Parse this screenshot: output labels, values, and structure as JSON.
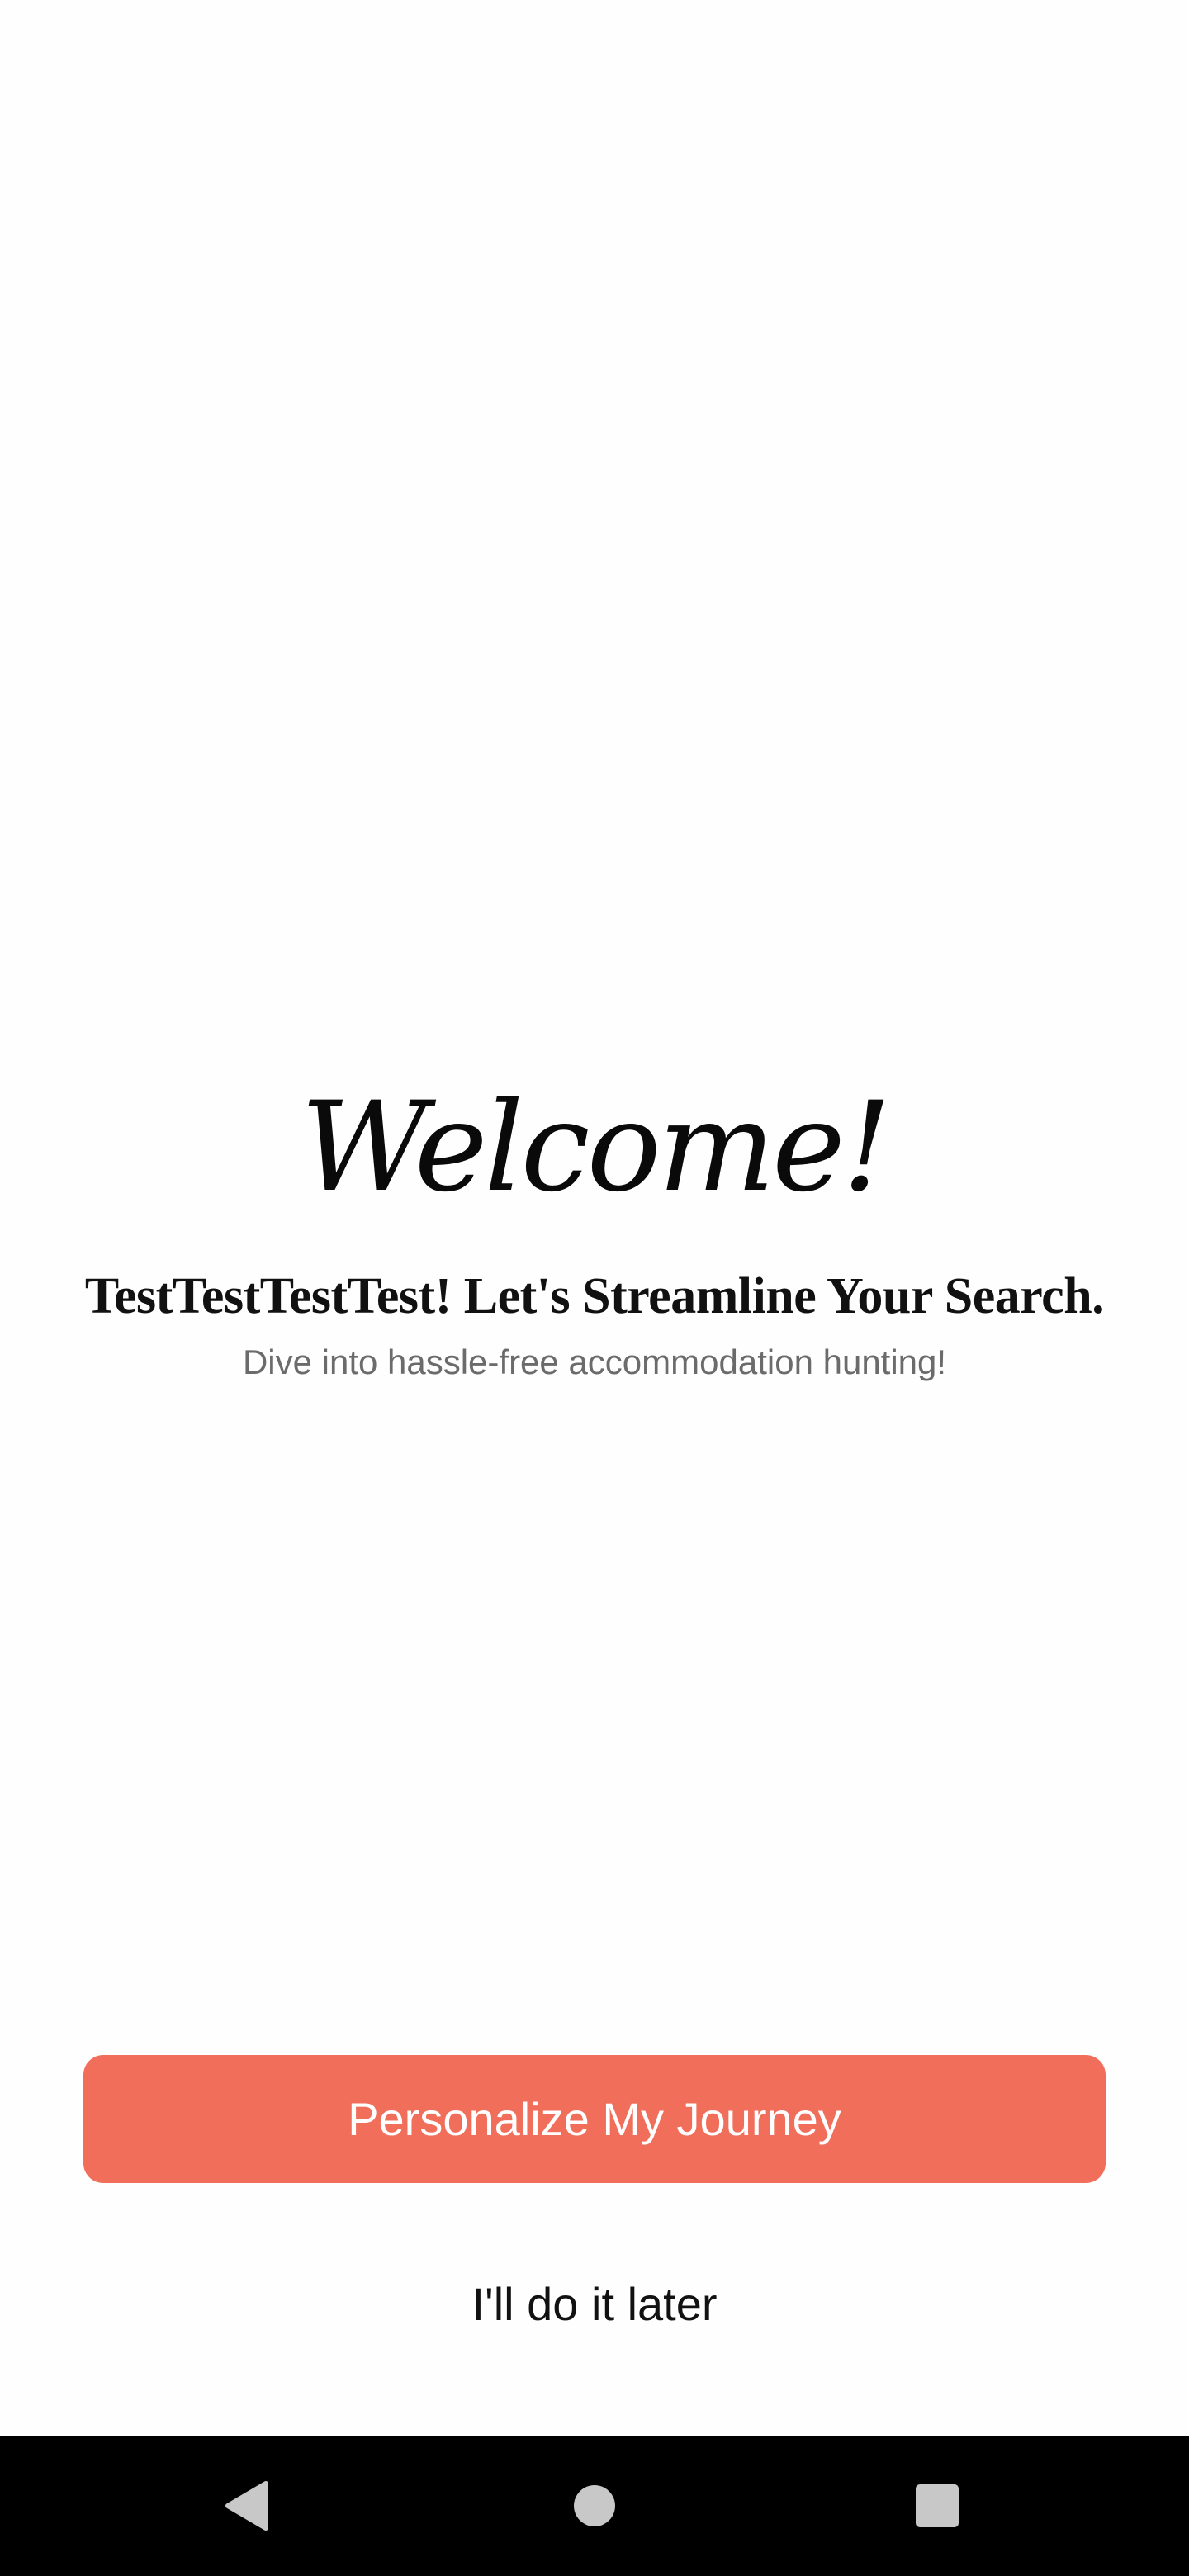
{
  "welcome": {
    "title": "Welcome!",
    "headline": "TestTestTestTest! Let's Streamline Your Search.",
    "subtitle": "Dive into hassle-free accommodation hunting!"
  },
  "actions": {
    "primary_label": "Personalize My Journey",
    "secondary_label": "I'll do it later"
  },
  "colors": {
    "accent": "#f06e5a",
    "background": "#fefefe",
    "nav_bar": "#000000"
  },
  "nav": {
    "icons": [
      "back-icon",
      "home-icon",
      "recents-icon"
    ]
  }
}
